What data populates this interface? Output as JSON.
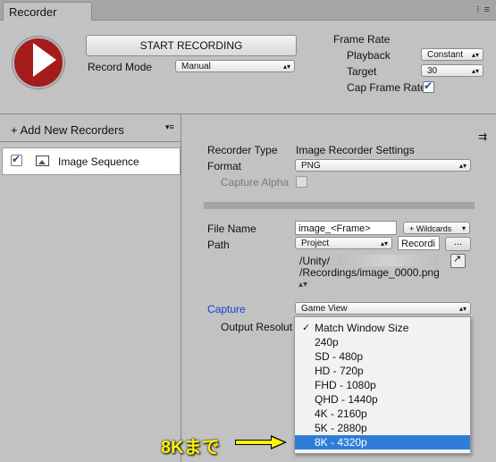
{
  "window": {
    "tab_title": "Recorder"
  },
  "header": {
    "start_label": "START RECORDING",
    "record_mode_label": "Record Mode",
    "record_mode_value": "Manual",
    "frame_rate_label": "Frame Rate",
    "playback_label": "Playback",
    "playback_value": "Constant",
    "target_label": "Target",
    "target_value": "30",
    "cap_label": "Cap Frame Rate",
    "cap_checked": true
  },
  "sidebar": {
    "add_label": "+ Add New Recorders",
    "items": [
      {
        "label": "Image Sequence",
        "checked": true
      }
    ]
  },
  "settings": {
    "recorder_type_label": "Recorder Type",
    "recorder_type_value": "Image Recorder Settings",
    "format_label": "Format",
    "format_value": "PNG",
    "capture_alpha_label": "Capture Alpha",
    "file_name_label": "File Name",
    "file_name_value": "image_<Frame>",
    "wildcards_label": "+ Wildcards",
    "path_label": "Path",
    "path_root_value": "Project",
    "path_value": "Recordi",
    "browse_label": "...",
    "path_line1": "/Unity/",
    "path_line2": "/Recordings/image_0000.png",
    "capture_label": "Capture",
    "capture_value": "Game View",
    "output_res_label": "Output Resolut"
  },
  "resolution_menu": {
    "options": [
      "Match Window Size",
      "240p",
      "SD - 480p",
      "HD - 720p",
      "FHD - 1080p",
      "QHD - 1440p",
      "4K - 2160p",
      "5K - 2880p",
      "8K - 4320p"
    ],
    "checked": "Match Window Size",
    "highlighted": "8K - 4320p"
  },
  "annotation": {
    "text": "8Kまで",
    "color": "#fdf10a"
  },
  "colors": {
    "accent": "#2f7dd9",
    "record": "#a51c1c",
    "link": "#1a3fcf"
  }
}
